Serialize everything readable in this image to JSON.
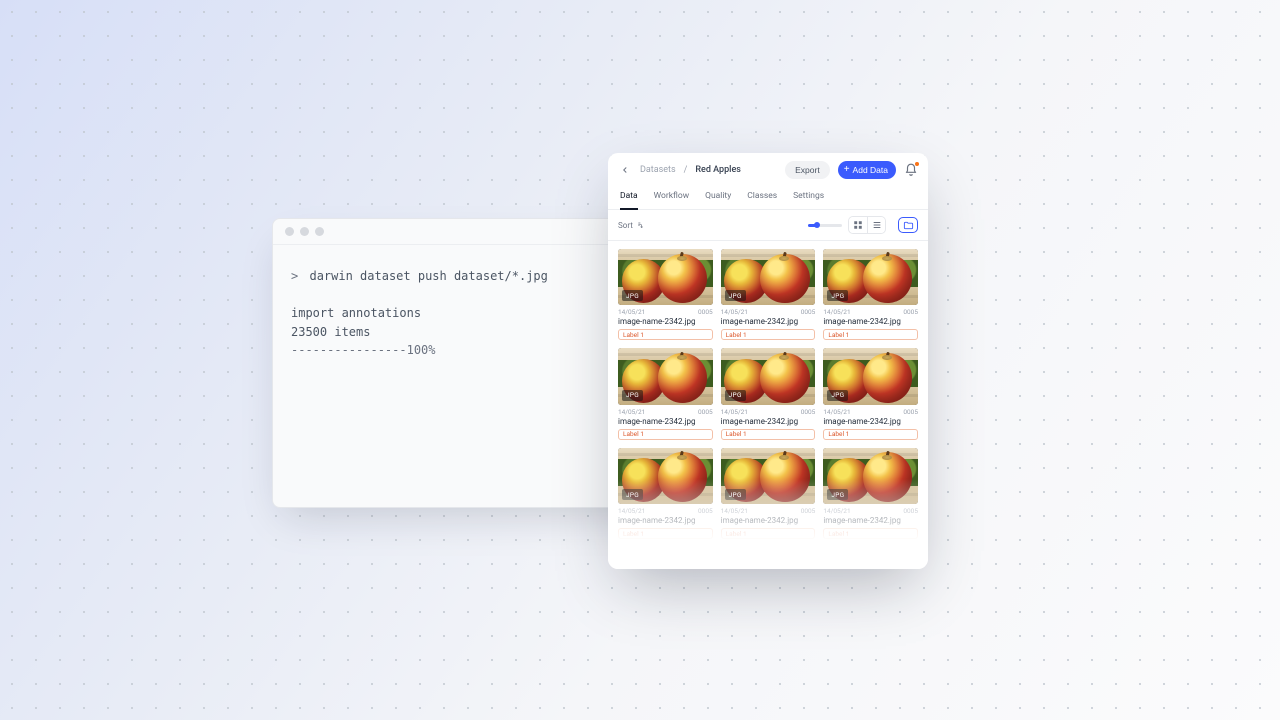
{
  "terminal": {
    "prompt": ">",
    "command": "darwin dataset push dataset/*.jpg",
    "line1": "import annotations",
    "line2": "23500 items",
    "progress": "----------------100%"
  },
  "app": {
    "breadcrumb": {
      "root": "Datasets",
      "sep": "/",
      "current": "Red Apples"
    },
    "buttons": {
      "export": "Export",
      "add": "Add Data"
    },
    "tabs": [
      "Data",
      "Workflow",
      "Quality",
      "Classes",
      "Settings"
    ],
    "active_tab": 0,
    "toolbar": {
      "sort_label": "Sort"
    },
    "card": {
      "badge": "JPG",
      "date": "14/05/21",
      "index": "0005",
      "filename": "image-name-2342.jpg",
      "label": "Label 1"
    }
  }
}
